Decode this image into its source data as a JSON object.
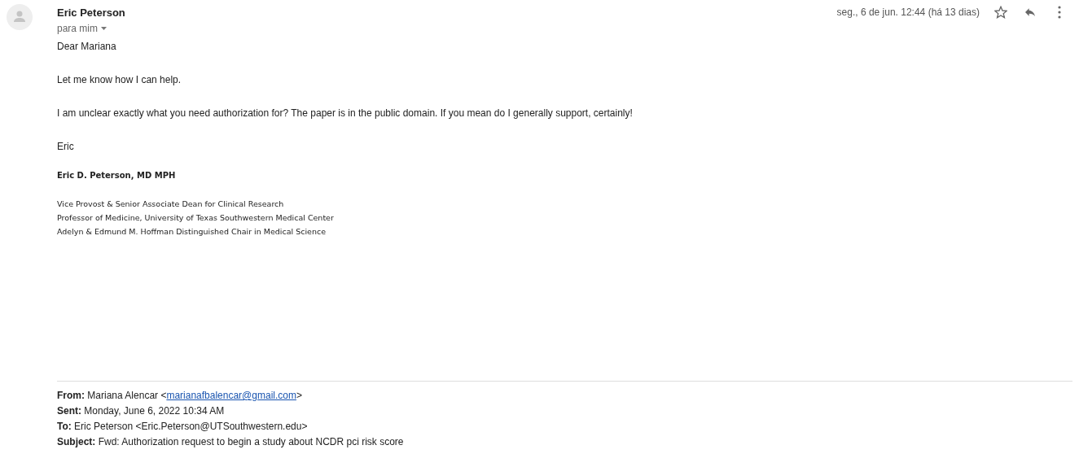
{
  "message": {
    "sender": "Eric Peterson",
    "recipient": "para mim",
    "date": "seg., 6 de jun. 12:44 (há 13 dias)",
    "starred": false,
    "body": [
      "Dear Mariana",
      "Let me know how I can help.",
      "I am unclear exactly what you need authorization for? The paper is in the public domain.  If you mean do I generally support, certainly!",
      "Eric"
    ],
    "signature": {
      "name": "Eric D. Peterson, MD MPH",
      "lines": [
        "Vice Provost & Senior Associate Dean for Clinical Research",
        "Professor of Medicine, University of Texas Southwestern Medical Center",
        "Adelyn & Edmund M. Hoffman Distinguished Chair in Medical Science"
      ]
    },
    "quoted_header": [
      {
        "text": "**From:** Mariana Alencar <",
        "link": "marianafbalencar@gmail.com",
        "after": ">"
      },
      {
        "text": "**Sent:** Monday, June 6, 2022 10:34 AM"
      },
      {
        "text": "**To:** Eric Peterson <Eric.Peterson@UTSouthwestern.edu>"
      },
      {
        "text": "**Subject:** Fwd: Authorization request to begin a study about NCDR pci risk score"
      }
    ]
  }
}
